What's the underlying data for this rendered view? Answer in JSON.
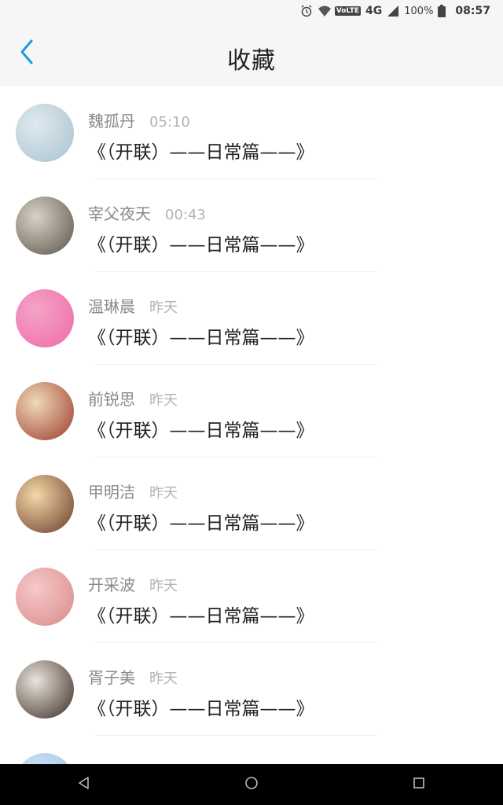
{
  "status_bar": {
    "icons": [
      "alarm-icon",
      "wifi-icon",
      "volte-icon",
      "signal-icon",
      "battery-icon"
    ],
    "volte": "VoLTE",
    "network": "4G",
    "battery": "100%",
    "time": "08:57"
  },
  "header": {
    "back_icon": "chevron-left-icon",
    "title": "收藏",
    "accent": "#1e9be8"
  },
  "favorites": [
    {
      "name": "魏孤丹",
      "time": "05:10",
      "title": "《（开联）——日常篇——》",
      "avatar_colors": [
        "#dfe9ef",
        "#a9c2cf"
      ]
    },
    {
      "name": "宰父夜天",
      "time": "00:43",
      "title": "《（开联）——日常篇——》",
      "avatar_colors": [
        "#d8d2c6",
        "#5a5348"
      ]
    },
    {
      "name": "温琳晨",
      "time": "昨天",
      "title": "《（开联）——日常篇——》",
      "avatar_colors": [
        "#f4a3c8",
        "#ef6aa8"
      ]
    },
    {
      "name": "前锐思",
      "time": "昨天",
      "title": "《（开联）——日常篇——》",
      "avatar_colors": [
        "#f0d9b7",
        "#9b3a2b"
      ]
    },
    {
      "name": "甲明洁",
      "time": "昨天",
      "title": "《（开联）——日常篇——》",
      "avatar_colors": [
        "#f3d9a8",
        "#6a3a2a"
      ]
    },
    {
      "name": "开采波",
      "time": "昨天",
      "title": "《（开联）——日常篇——》",
      "avatar_colors": [
        "#f7c8c8",
        "#d98a8a"
      ]
    },
    {
      "name": "胥子美",
      "time": "昨天",
      "title": "《（开联）——日常篇——》",
      "avatar_colors": [
        "#e9e4dc",
        "#3b2a22"
      ]
    },
    {
      "name": "",
      "time": "",
      "title": "",
      "avatar_colors": [
        "#cfe2f5",
        "#9cc3ea"
      ]
    }
  ],
  "nav_bar": {
    "back_icon": "nav-back-triangle-icon",
    "home_icon": "nav-home-circle-icon",
    "recents_icon": "nav-recents-square-icon"
  }
}
